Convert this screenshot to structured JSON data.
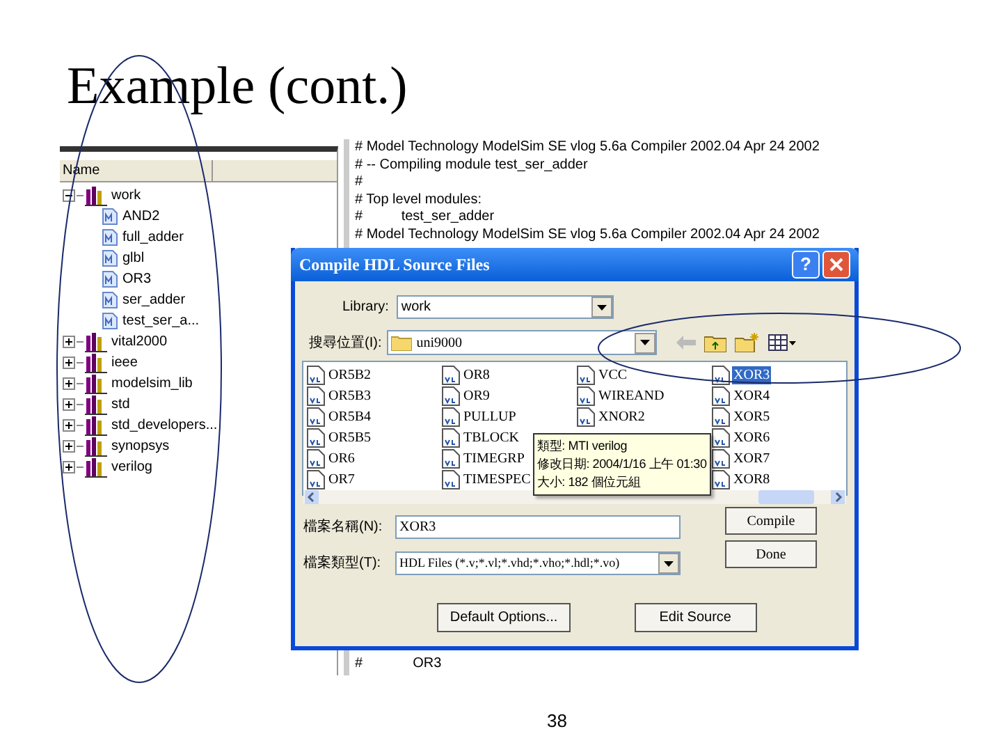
{
  "slide": {
    "title": "Example (cont.)",
    "page_number": "38"
  },
  "tree": {
    "header": "Name",
    "items": [
      {
        "label": "work",
        "expanded": true,
        "children": [
          {
            "label": "AND2"
          },
          {
            "label": "full_adder"
          },
          {
            "label": "glbl"
          },
          {
            "label": "OR3"
          },
          {
            "label": "ser_adder"
          },
          {
            "label": "test_ser_a..."
          }
        ]
      },
      {
        "label": "vital2000",
        "expanded": false
      },
      {
        "label": "ieee",
        "expanded": false
      },
      {
        "label": "modelsim_lib",
        "expanded": false
      },
      {
        "label": "std",
        "expanded": false
      },
      {
        "label": "std_developers...",
        "expanded": false
      },
      {
        "label": "synopsys",
        "expanded": false
      },
      {
        "label": "verilog",
        "expanded": false
      }
    ]
  },
  "console": {
    "lines": [
      "# Model Technology ModelSim SE vlog 5.6a Compiler 2002.04 Apr 24 2002",
      "# -- Compiling module test_ser_adder",
      "#",
      "# Top level modules:",
      "#          test_ser_adder",
      "# Model Technology ModelSim SE vlog 5.6a Compiler 2002.04 Apr 24 2002"
    ],
    "bottom_line": {
      "hash": "#",
      "text": "OR3"
    }
  },
  "dialog": {
    "title": "Compile HDL Source Files",
    "help": "?",
    "library": {
      "label": "Library:",
      "value": "work"
    },
    "look_in": {
      "label": "搜尋位置(I):",
      "value": "uni9000"
    },
    "files": [
      [
        {
          "name": "OR5B2",
          "selected": false
        },
        {
          "name": "OR5B3",
          "selected": false
        },
        {
          "name": "OR5B4",
          "selected": false
        },
        {
          "name": "OR5B5",
          "selected": false
        },
        {
          "name": "OR6",
          "selected": false
        },
        {
          "name": "OR7",
          "selected": false
        }
      ],
      [
        {
          "name": "OR8",
          "selected": false
        },
        {
          "name": "OR9",
          "selected": false
        },
        {
          "name": "PULLUP",
          "selected": false
        },
        {
          "name": "TBLOCK",
          "selected": false
        },
        {
          "name": "TIMEGRP",
          "selected": false
        },
        {
          "name": "TIMESPEC",
          "selected": false
        }
      ],
      [
        {
          "name": "VCC",
          "selected": false
        },
        {
          "name": "WIREAND",
          "selected": false
        },
        {
          "name": "XNOR2",
          "selected": false
        }
      ],
      [
        {
          "name": "XOR3",
          "selected": true
        },
        {
          "name": "XOR4",
          "selected": false
        },
        {
          "name": "XOR5",
          "selected": false
        },
        {
          "name": "XOR6",
          "selected": false
        },
        {
          "name": "XOR7",
          "selected": false
        },
        {
          "name": "XOR8",
          "selected": false
        }
      ]
    ],
    "tooltip": [
      "類型: MTI verilog",
      "修改日期: 2004/1/16 上午 01:30",
      "大小: 182 個位元組"
    ],
    "file_name": {
      "label": "檔案名稱(N):",
      "value": "XOR3"
    },
    "file_type": {
      "label": "檔案類型(T):",
      "value": "HDL Files (*.v;*.vl;*.vhd;*.vho;*.hdl;*.vo)"
    },
    "buttons": [
      "Compile",
      "Done"
    ],
    "bottom_buttons": [
      "Default Options...",
      "Edit Source"
    ]
  }
}
